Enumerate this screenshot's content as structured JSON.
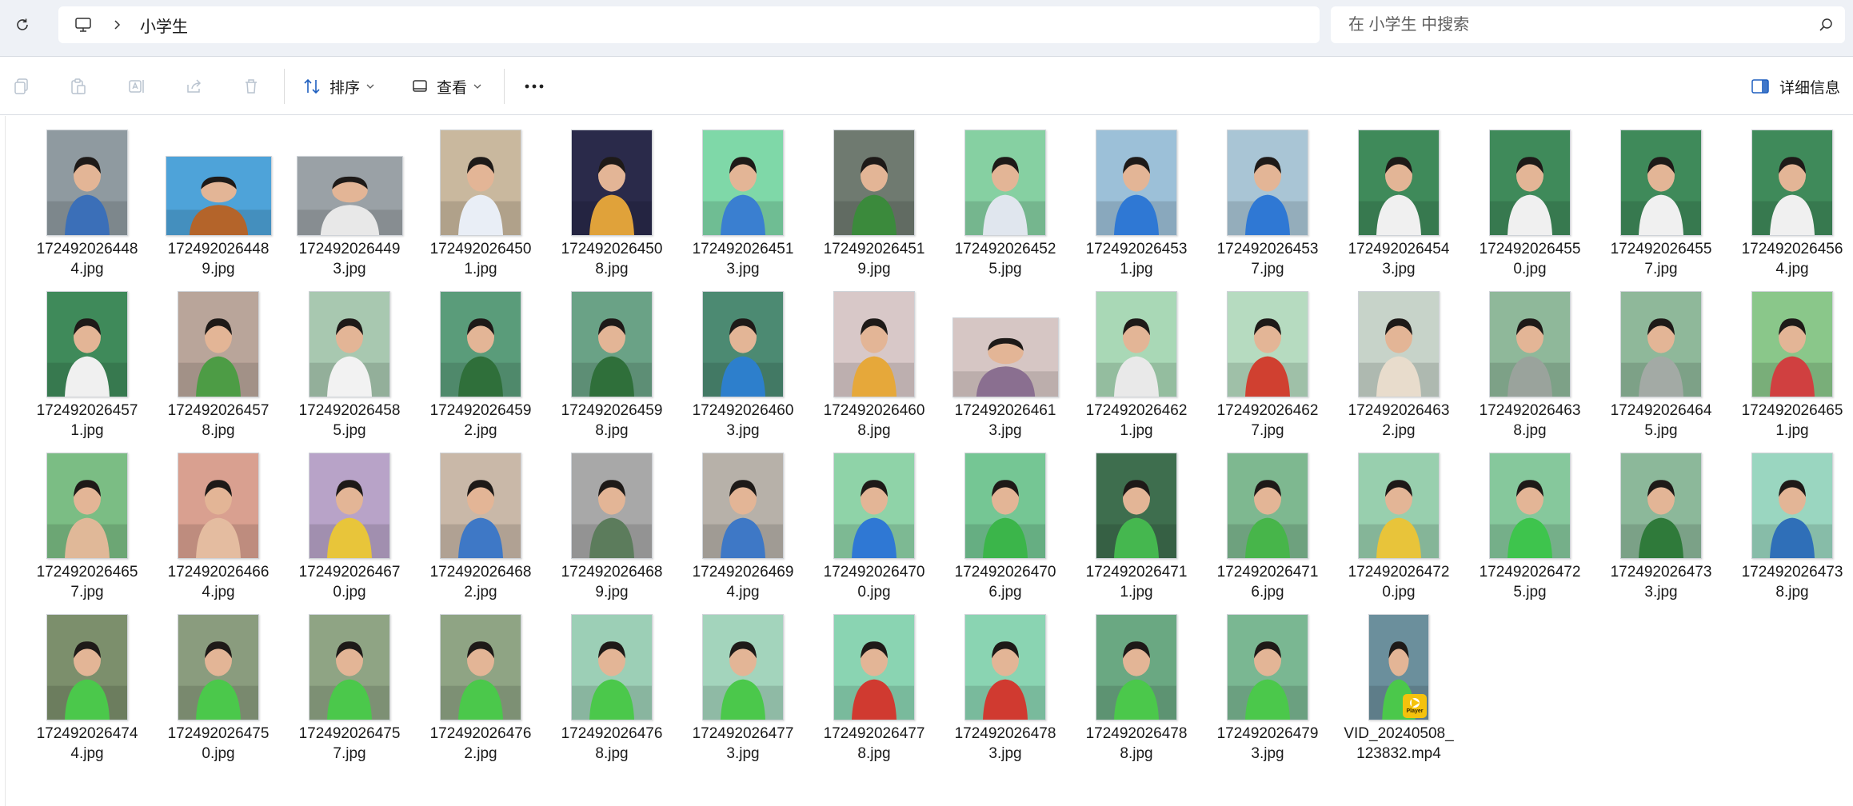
{
  "address": {
    "location_label": "小学生",
    "search_placeholder": "在 小学生 中搜索"
  },
  "toolbar": {
    "sort_label": "排序",
    "view_label": "查看",
    "details_label": "详细信息"
  },
  "colors": {
    "accent": "#1f5fbf",
    "address_bg": "#eef1f6"
  },
  "files": [
    {
      "line1": "172492026448",
      "line2": "4.jpg",
      "orient": "portrait",
      "bg": "#8f9aa0",
      "fg": "#3b6fb8"
    },
    {
      "line1": "172492026448",
      "line2": "9.jpg",
      "orient": "landscape",
      "bg": "#4ea3d9",
      "fg": "#b4642a"
    },
    {
      "line1": "172492026449",
      "line2": "3.jpg",
      "orient": "landscape",
      "bg": "#9aa1a6",
      "fg": "#e8e8e8"
    },
    {
      "line1": "172492026450",
      "line2": "1.jpg",
      "orient": "portrait",
      "bg": "#c9b89e",
      "fg": "#e9eef6"
    },
    {
      "line1": "172492026450",
      "line2": "8.jpg",
      "orient": "portrait",
      "bg": "#2a2a4a",
      "fg": "#e0a23a"
    },
    {
      "line1": "172492026451",
      "line2": "3.jpg",
      "orient": "portrait",
      "bg": "#7fd8a8",
      "fg": "#3a7fd0"
    },
    {
      "line1": "172492026451",
      "line2": "9.jpg",
      "orient": "portrait",
      "bg": "#6f7a70",
      "fg": "#3b8a3c"
    },
    {
      "line1": "172492026452",
      "line2": "5.jpg",
      "orient": "portrait",
      "bg": "#86d0a2",
      "fg": "#e0e6ee"
    },
    {
      "line1": "172492026453",
      "line2": "1.jpg",
      "orient": "portrait",
      "bg": "#9cc0d8",
      "fg": "#2f78d4"
    },
    {
      "line1": "172492026453",
      "line2": "7.jpg",
      "orient": "portrait",
      "bg": "#a9c5d5",
      "fg": "#2f78d4"
    },
    {
      "line1": "172492026454",
      "line2": "3.jpg",
      "orient": "portrait",
      "bg": "#3f8a5a",
      "fg": "#f0f0f0"
    },
    {
      "line1": "172492026455",
      "line2": "0.jpg",
      "orient": "portrait",
      "bg": "#3f8a5a",
      "fg": "#f0f0f0"
    },
    {
      "line1": "172492026455",
      "line2": "7.jpg",
      "orient": "portrait",
      "bg": "#3f8a5a",
      "fg": "#f0f0f0"
    },
    {
      "line1": "172492026456",
      "line2": "4.jpg",
      "orient": "portrait",
      "bg": "#3f8a5a",
      "fg": "#f0f0f0"
    },
    {
      "line1": "172492026457",
      "line2": "1.jpg",
      "orient": "portrait",
      "bg": "#3f8a5a",
      "fg": "#f0f0f0"
    },
    {
      "line1": "172492026457",
      "line2": "8.jpg",
      "orient": "portrait",
      "bg": "#b9a59a",
      "fg": "#4d9c45"
    },
    {
      "line1": "172492026458",
      "line2": "5.jpg",
      "orient": "portrait",
      "bg": "#a8c8b0",
      "fg": "#f2f2f2"
    },
    {
      "line1": "172492026459",
      "line2": "2.jpg",
      "orient": "portrait",
      "bg": "#5a9c7a",
      "fg": "#2f6f3a"
    },
    {
      "line1": "172492026459",
      "line2": "8.jpg",
      "orient": "portrait",
      "bg": "#6aa286",
      "fg": "#2f6f3a"
    },
    {
      "line1": "172492026460",
      "line2": "3.jpg",
      "orient": "portrait",
      "bg": "#4c8a72",
      "fg": "#2d7fcc"
    },
    {
      "line1": "172492026460",
      "line2": "8.jpg",
      "orient": "portrait",
      "bg": "#d8c8c8",
      "fg": "#e6a83a"
    },
    {
      "line1": "172492026461",
      "line2": "3.jpg",
      "orient": "landscape",
      "bg": "#d6c6c4",
      "fg": "#8a6f90"
    },
    {
      "line1": "172492026462",
      "line2": "1.jpg",
      "orient": "portrait",
      "bg": "#a9d8b6",
      "fg": "#e9e9e9"
    },
    {
      "line1": "172492026462",
      "line2": "7.jpg",
      "orient": "portrait",
      "bg": "#b6dbc0",
      "fg": "#d04030"
    },
    {
      "line1": "172492026463",
      "line2": "2.jpg",
      "orient": "portrait",
      "bg": "#c7d3c9",
      "fg": "#e8dccc"
    },
    {
      "line1": "172492026463",
      "line2": "8.jpg",
      "orient": "portrait",
      "bg": "#8fb89a",
      "fg": "#9aa39c"
    },
    {
      "line1": "172492026464",
      "line2": "5.jpg",
      "orient": "portrait",
      "bg": "#8fb89a",
      "fg": "#a3aaa5"
    },
    {
      "line1": "172492026465",
      "line2": "1.jpg",
      "orient": "portrait",
      "bg": "#8ac78a",
      "fg": "#d04040"
    },
    {
      "line1": "172492026465",
      "line2": "7.jpg",
      "orient": "portrait",
      "bg": "#7bbd84",
      "fg": "#e0b898"
    },
    {
      "line1": "172492026466",
      "line2": "4.jpg",
      "orient": "portrait",
      "bg": "#d9a090",
      "fg": "#e4bca0"
    },
    {
      "line1": "172492026467",
      "line2": "0.jpg",
      "orient": "portrait",
      "bg": "#b8a3c8",
      "fg": "#e8c53a"
    },
    {
      "line1": "172492026468",
      "line2": "2.jpg",
      "orient": "portrait",
      "bg": "#c9b8a8",
      "fg": "#3e78c6"
    },
    {
      "line1": "172492026468",
      "line2": "9.jpg",
      "orient": "portrait",
      "bg": "#a8a8a8",
      "fg": "#5c7c5c"
    },
    {
      "line1": "172492026469",
      "line2": "4.jpg",
      "orient": "portrait",
      "bg": "#b7b1a9",
      "fg": "#3e78c6"
    },
    {
      "line1": "172492026470",
      "line2": "0.jpg",
      "orient": "portrait",
      "bg": "#8fd3a8",
      "fg": "#2f78d4"
    },
    {
      "line1": "172492026470",
      "line2": "6.jpg",
      "orient": "portrait",
      "bg": "#75c694",
      "fg": "#3bb54a"
    },
    {
      "line1": "172492026471",
      "line2": "1.jpg",
      "orient": "portrait",
      "bg": "#3e6e4e",
      "fg": "#45b74f"
    },
    {
      "line1": "172492026471",
      "line2": "6.jpg",
      "orient": "portrait",
      "bg": "#7eb890",
      "fg": "#47b54a"
    },
    {
      "line1": "172492026472",
      "line2": "0.jpg",
      "orient": "portrait",
      "bg": "#98cfae",
      "fg": "#e8c43a"
    },
    {
      "line1": "172492026472",
      "line2": "5.jpg",
      "orient": "portrait",
      "bg": "#86c89c",
      "fg": "#3ec44d"
    },
    {
      "line1": "172492026473",
      "line2": "3.jpg",
      "orient": "portrait",
      "bg": "#8cb89a",
      "fg": "#2f7a3a"
    },
    {
      "line1": "172492026473",
      "line2": "8.jpg",
      "orient": "portrait",
      "bg": "#9ad6c0",
      "fg": "#2f6fb8"
    },
    {
      "line1": "172492026474",
      "line2": "4.jpg",
      "orient": "portrait",
      "bg": "#7c8f6c",
      "fg": "#4bc84b"
    },
    {
      "line1": "172492026475",
      "line2": "0.jpg",
      "orient": "portrait",
      "bg": "#8a9c7e",
      "fg": "#4bc84b"
    },
    {
      "line1": "172492026475",
      "line2": "7.jpg",
      "orient": "portrait",
      "bg": "#8fa484",
      "fg": "#4bc84b"
    },
    {
      "line1": "172492026476",
      "line2": "2.jpg",
      "orient": "portrait",
      "bg": "#8fa484",
      "fg": "#4bc84b"
    },
    {
      "line1": "172492026476",
      "line2": "8.jpg",
      "orient": "portrait",
      "bg": "#9ccfb6",
      "fg": "#4bc84b"
    },
    {
      "line1": "172492026477",
      "line2": "3.jpg",
      "orient": "portrait",
      "bg": "#a3d4bc",
      "fg": "#4bc84b"
    },
    {
      "line1": "172492026477",
      "line2": "8.jpg",
      "orient": "portrait",
      "bg": "#8ad4b2",
      "fg": "#d03a30"
    },
    {
      "line1": "172492026478",
      "line2": "3.jpg",
      "orient": "portrait",
      "bg": "#8ad4b2",
      "fg": "#d03a30"
    },
    {
      "line1": "172492026478",
      "line2": "8.jpg",
      "orient": "portrait",
      "bg": "#6aa882",
      "fg": "#4bc84b"
    },
    {
      "line1": "172492026479",
      "line2": "3.jpg",
      "orient": "portrait",
      "bg": "#7ab792",
      "fg": "#4bc84b"
    },
    {
      "line1": "VID_20240508_",
      "line2": "123832.mp4",
      "orient": "video",
      "bg": "#6b8f9c",
      "fg": "#4bc84b",
      "badge": "Player"
    }
  ]
}
